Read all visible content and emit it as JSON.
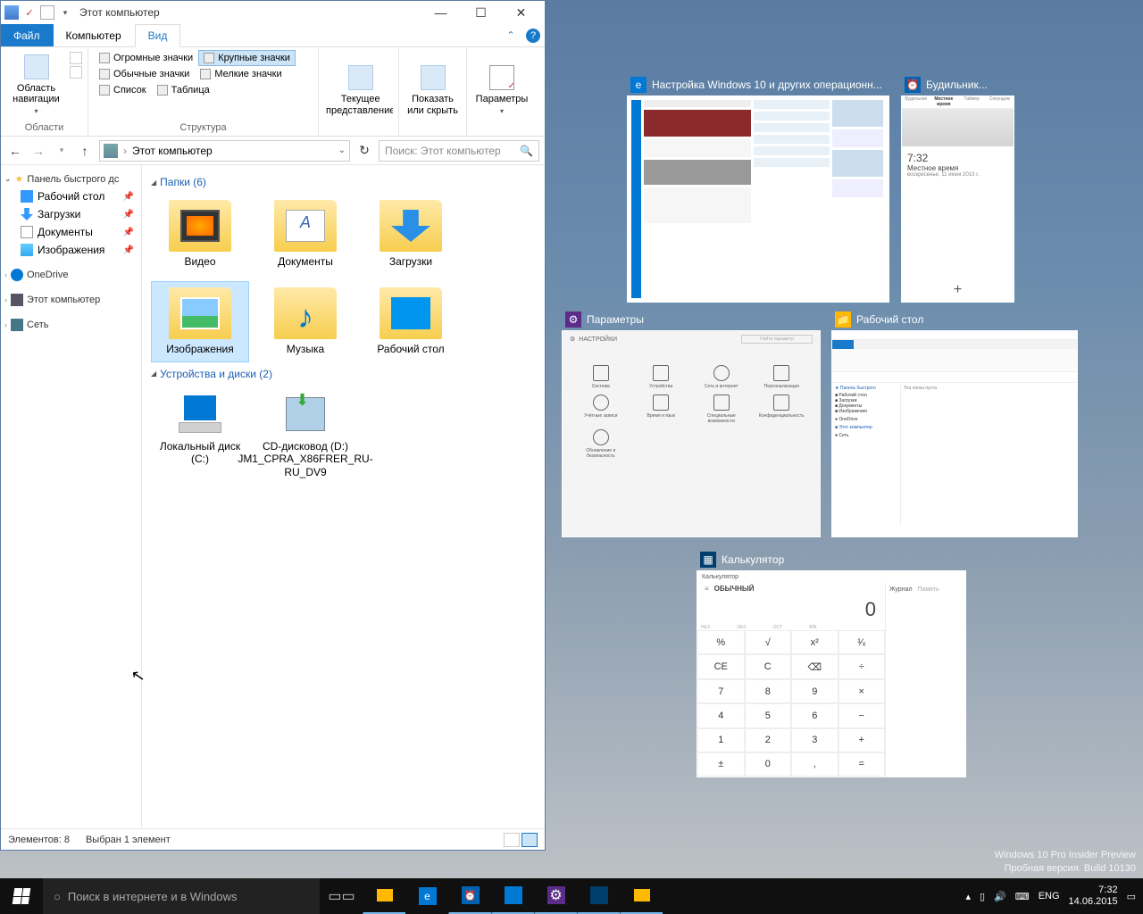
{
  "explorer": {
    "title": "Этот компьютер",
    "tabs": {
      "file": "Файл",
      "computer": "Компьютер",
      "view": "Вид"
    },
    "ribbon": {
      "nav_panes": "Область навигации",
      "areas": "Области",
      "layout_opts": {
        "huge": "Огромные значки",
        "large": "Крупные значки",
        "normal": "Обычные значки",
        "small": "Мелкие значки",
        "list": "Список",
        "table": "Таблица"
      },
      "layout": "Структура",
      "current_view": "Текущее представление",
      "show_hide": "Показать или скрыть",
      "options": "Параметры"
    },
    "address": "Этот компьютер",
    "search_ph": "Поиск: Этот компьютер",
    "tree": {
      "quick": "Панель быстрого дс",
      "items": [
        {
          "label": "Рабочий стол"
        },
        {
          "label": "Загрузки"
        },
        {
          "label": "Документы"
        },
        {
          "label": "Изображения"
        }
      ],
      "onedrive": "OneDrive",
      "thispc": "Этот компьютер",
      "network": "Сеть"
    },
    "groups": {
      "folders_hdr": "Папки (6)",
      "folders": [
        {
          "label": "Видео"
        },
        {
          "label": "Документы"
        },
        {
          "label": "Загрузки"
        },
        {
          "label": "Изображения"
        },
        {
          "label": "Музыка"
        },
        {
          "label": "Рабочий стол"
        }
      ],
      "drives_hdr": "Устройства и диски (2)",
      "drives": [
        {
          "label": "Локальный диск (C:)"
        },
        {
          "label": "CD-дисковод (D:) JM1_CPRA_X86FRER_RU-RU_DV9"
        }
      ]
    },
    "status": {
      "items": "Элементов: 8",
      "selected": "Выбран 1 элемент"
    }
  },
  "thumbs": {
    "browser": "Настройка Windows 10 и других операционн...",
    "alarm": "Будильник...",
    "alarm_time": "7:32",
    "alarm_loc": "Местное время",
    "alarm_date": "воскресенье, 11 июня 2015 г.",
    "settings": "Параметры",
    "settings_hdr": "НАСТРОЙКИ",
    "desktop": "Рабочий стол",
    "calc": "Калькулятор",
    "calc_mode": "ОБЫЧНЫЙ",
    "calc_val": "0",
    "calc_journal": "Журнал",
    "calc_mem": "Память"
  },
  "taskbar": {
    "search": "Поиск в интернете и в Windows",
    "lang": "ENG",
    "time": "7:32",
    "date": "14.06.2015"
  },
  "watermark": {
    "l1": "Windows 10 Pro Insider Preview",
    "l2": "Пробная версия. Build 10130"
  }
}
